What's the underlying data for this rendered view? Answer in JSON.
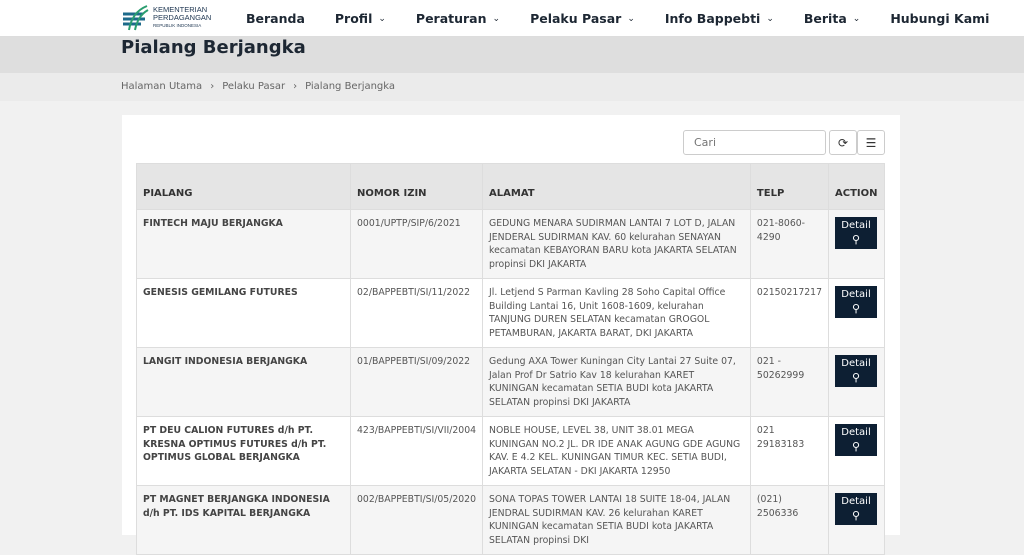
{
  "logo": {
    "line1": "KEMENTERIAN",
    "line2": "PERDAGANGAN",
    "line3": "REPUBLIK INDONESIA"
  },
  "nav": [
    {
      "label": "Beranda"
    },
    {
      "label": "Profil",
      "dropdown": true
    },
    {
      "label": "Peraturan",
      "dropdown": true
    },
    {
      "label": "Pelaku Pasar",
      "dropdown": true
    },
    {
      "label": "Info Bappebti",
      "dropdown": true
    },
    {
      "label": "Berita",
      "dropdown": true
    },
    {
      "label": "Hubungi Kami"
    }
  ],
  "page_title": "Pialang Berjangka",
  "breadcrumb": [
    "Halaman Utama",
    "Pelaku Pasar",
    "Pialang Berjangka"
  ],
  "search": {
    "placeholder": "Cari"
  },
  "table": {
    "headers": [
      "PIALANG",
      "NOMOR IZIN",
      "ALAMAT",
      "TELP",
      "ACTION"
    ],
    "rows": [
      {
        "pialang": "FINTECH MAJU BERJANGKA",
        "izin": "0001/UPTP/SIP/6/2021",
        "alamat": "GEDUNG MENARA SUDIRMAN LANTAI 7 LOT D, JALAN JENDERAL SUDIRMAN KAV. 60 kelurahan SENAYAN kecamatan KEBAYORAN BARU kota JAKARTA SELATAN propinsi DKI JAKARTA",
        "telp": "021-8060-4290"
      },
      {
        "pialang": "GENESIS GEMILANG FUTURES",
        "izin": "02/BAPPEBTI/SI/11/2022",
        "alamat": "Jl. Letjend S Parman Kavling 28 Soho Capital Office Building Lantai 16, Unit 1608-1609, kelurahan TANJUNG DUREN SELATAN kecamatan GROGOL PETAMBURAN, JAKARTA BARAT, DKI JAKARTA",
        "telp": "02150217217"
      },
      {
        "pialang": "LANGIT INDONESIA BERJANGKA",
        "izin": "01/BAPPEBTI/SI/09/2022",
        "alamat": "Gedung AXA Tower Kuningan City Lantai 27 Suite 07, Jalan Prof Dr Satrio Kav 18 kelurahan KARET KUNINGAN kecamatan SETIA BUDI kota JAKARTA SELATAN propinsi DKI JAKARTA",
        "telp": "021 - 50262999"
      },
      {
        "pialang": "PT DEU CALION FUTURES d/h PT. KRESNA OPTIMUS FUTURES d/h PT. OPTIMUS GLOBAL BERJANGKA",
        "izin": "423/BAPPEBTI/SI/VII/2004",
        "alamat": "NOBLE HOUSE, LEVEL 38, UNIT 38.01 MEGA KUNINGAN NO.2 JL. DR IDE ANAK AGUNG GDE AGUNG KAV. E 4.2 KEL. KUNINGAN TIMUR KEC. SETIA BUDI, JAKARTA SELATAN - DKI JAKARTA 12950",
        "telp": "021 29183183"
      },
      {
        "pialang": "PT MAGNET BERJANGKA INDONESIA d/h PT. IDS KAPITAL BERJANGKA",
        "izin": "002/BAPPEBTI/SI/05/2020",
        "alamat": "SONA TOPAS TOWER LANTAI 18 SUITE 18-04, JALAN JENDRAL SUDIRMAN KAV. 26 kelurahan KARET KUNINGAN kecamatan SETIA BUDI kota JAKARTA SELATAN propinsi DKI",
        "telp": "(021) 2506336"
      }
    ],
    "detail_label": "Detail"
  }
}
